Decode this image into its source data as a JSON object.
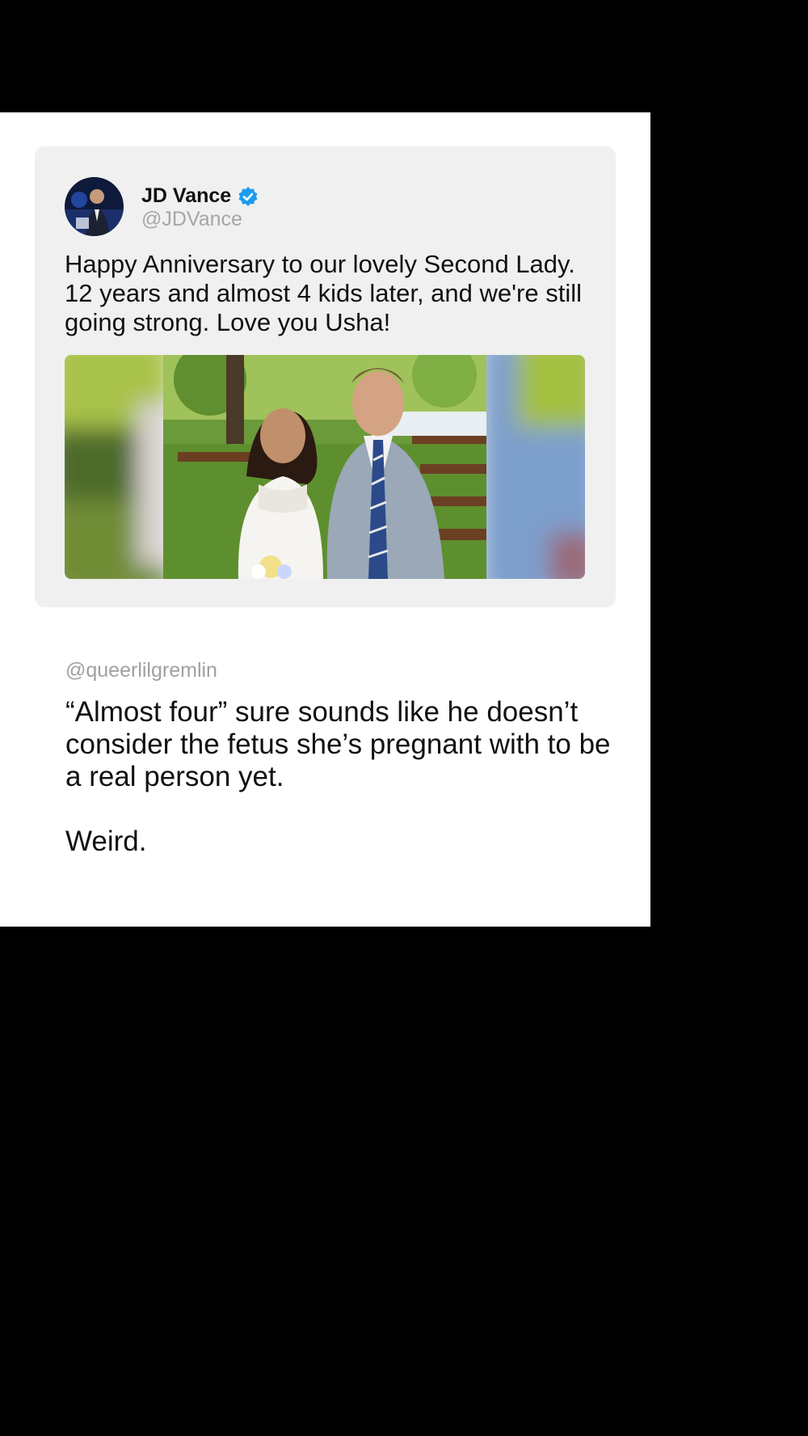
{
  "quoted_tweet": {
    "author_name": "JD Vance",
    "author_handle": "@JDVance",
    "verified_icon": "verified-badge-icon",
    "text": "Happy Anniversary to our lovely Second Lady. 12 years and almost 4 kids later, and we're still going strong. Love you Usha!",
    "badge_color": "#1d9bf0"
  },
  "reply": {
    "handle": "@queerlilgremlin",
    "text": "“Almost four” sure sounds like he doesn’t consider the fetus she’s pregnant with to be a real person yet.\n\nWeird."
  },
  "colors": {
    "background": "#000000",
    "card": "#ffffff",
    "quoted_card": "#f0f0f0",
    "handle_gray": "#a6a6a6"
  }
}
